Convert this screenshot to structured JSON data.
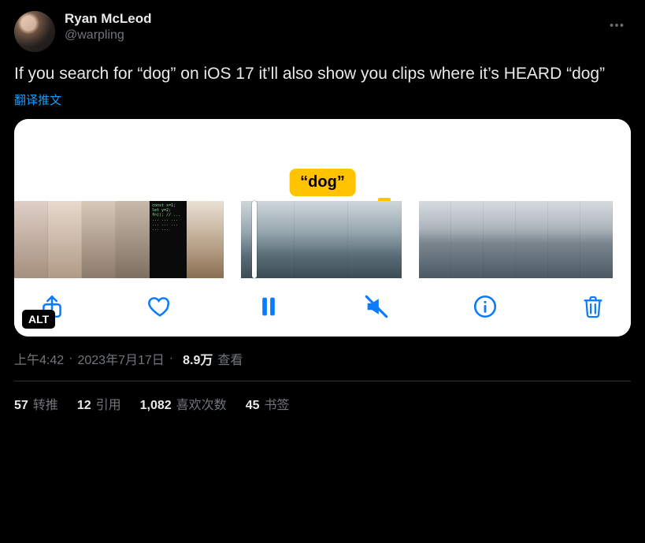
{
  "author": {
    "display_name": "Ryan McLeod",
    "handle": "@warpling"
  },
  "content": {
    "text": "If you search for “dog” on iOS 17 it’ll also show you clips where it’s HEARD “dog”",
    "translate_label": "翻译推文"
  },
  "media": {
    "tooltip": "“dog”",
    "alt_badge": "ALT"
  },
  "meta": {
    "time": "上午4:42",
    "date": "2023年7月17日",
    "sep": " · ",
    "views_count": "8.9万",
    "views_label": "查看"
  },
  "engagement": {
    "retweets": {
      "count": "57",
      "label": "转推"
    },
    "quotes": {
      "count": "12",
      "label": "引用"
    },
    "likes": {
      "count": "1,082",
      "label": "喜欢次数"
    },
    "bookmarks": {
      "count": "45",
      "label": "书签"
    }
  }
}
